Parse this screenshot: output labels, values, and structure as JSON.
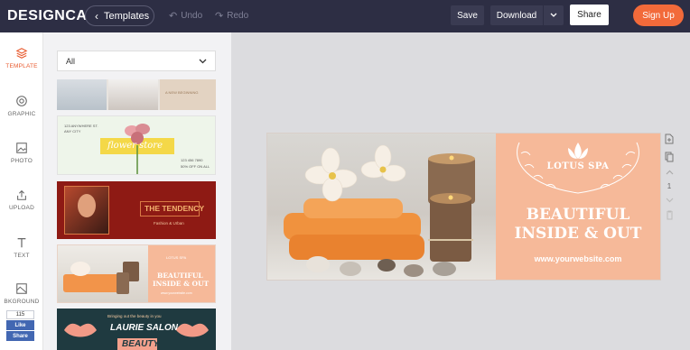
{
  "header": {
    "logo_text": "DESIGNCAP",
    "templates_label": "Templates",
    "undo_label": "Undo",
    "redo_label": "Redo",
    "save_label": "Save",
    "download_label": "Download",
    "share_label": "Share",
    "signup_label": "Sign Up"
  },
  "nav": {
    "items": [
      {
        "label": "TEMPLATE",
        "icon": "layers-icon"
      },
      {
        "label": "GRAPHIC",
        "icon": "graphic-icon"
      },
      {
        "label": "PHOTO",
        "icon": "photo-icon"
      },
      {
        "label": "UPLOAD",
        "icon": "upload-icon"
      },
      {
        "label": "TEXT",
        "icon": "text-icon"
      },
      {
        "label": "BKGROUND",
        "icon": "background-icon"
      }
    ],
    "fb": {
      "count": "115",
      "like": "Like",
      "share": "Share"
    }
  },
  "panel": {
    "category_selected": "All",
    "templates": [
      {
        "name": "first-template",
        "text": "A NEW BEGINNING"
      },
      {
        "name": "flower-store",
        "addr1": "123 ANYWHERE ST.",
        "addr2": "ANY CITY",
        "title": "flower store",
        "phone": "123 456 7890",
        "offer": "50% OFF ON ALL"
      },
      {
        "name": "the-tendency",
        "title": "THE TENDENCY",
        "subtitle": "Fashion & Urban"
      },
      {
        "name": "lotus-spa-thumb",
        "brand": "LOTUS SPA",
        "title1": "BEAUTIFUL",
        "title2": "INSIDE & OUT",
        "url": "www.yourwebsite.com"
      },
      {
        "name": "laurie-salon",
        "tagline": "Bringing out the beauty in you",
        "title": "LAURIE SALON",
        "title2": "BEAUTY"
      }
    ]
  },
  "design": {
    "brand": "LOTUS SPA",
    "headline1": "BEAUTIFUL",
    "headline2": "INSIDE & OUT",
    "website": "www.yourwebsite.com"
  },
  "side_tools": {
    "page_number": "1"
  },
  "colors": {
    "accent": "#f26a3a",
    "topbar": "#2d2e44",
    "peach": "#f6b999"
  }
}
